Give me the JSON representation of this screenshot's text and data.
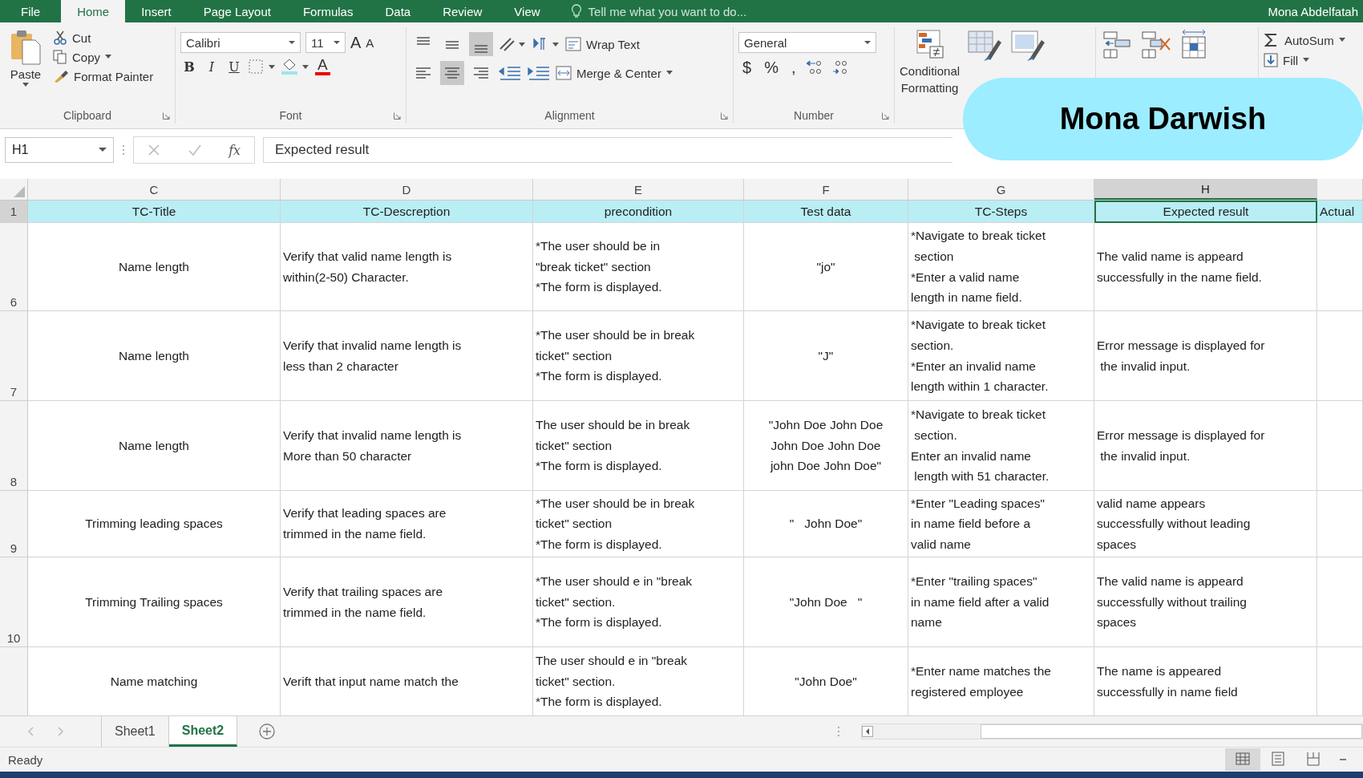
{
  "menu_tabs": [
    {
      "label": "File",
      "selected": false
    },
    {
      "label": "Home",
      "selected": true
    },
    {
      "label": "Insert",
      "selected": false
    },
    {
      "label": "Page Layout",
      "selected": false
    },
    {
      "label": "Formulas",
      "selected": false
    },
    {
      "label": "Data",
      "selected": false
    },
    {
      "label": "Review",
      "selected": false
    },
    {
      "label": "View",
      "selected": false
    }
  ],
  "tell_me": "Tell me what you want to do...",
  "user": "Mona Abdelfatah",
  "ribbon": {
    "clipboard": {
      "paste": "Paste",
      "cut": "Cut",
      "copy": "Copy",
      "format_painter": "Format Painter",
      "label": "Clipboard"
    },
    "font": {
      "name": "Calibri",
      "size": "11",
      "grow": "A",
      "shrink": "A",
      "bold": "B",
      "italic": "I",
      "underline": "U",
      "color_letter": "A",
      "label": "Font"
    },
    "alignment": {
      "vertical": [
        {
          "selected": false
        },
        {
          "selected": false
        },
        {
          "selected": true
        }
      ],
      "horizontal": [
        {
          "selected": false
        },
        {
          "selected": true
        },
        {
          "selected": false
        }
      ],
      "wrap_text": "Wrap Text",
      "merge": "Merge & Center",
      "label": "Alignment"
    },
    "number": {
      "format": "General",
      "currency": "$",
      "percent": "%",
      "comma": ",",
      "label": "Number"
    },
    "styles": {
      "conditional": "Conditional",
      "conditional_2": "Formatting"
    },
    "editing": {
      "autosum": "AutoSum",
      "fill": "Fill"
    }
  },
  "name_badge": "Mona Darwish",
  "formula_bar": {
    "name_box": "H1",
    "fx": "fx",
    "content": "Expected result"
  },
  "columns": [
    {
      "letter": "C",
      "selected": false
    },
    {
      "letter": "D",
      "selected": false
    },
    {
      "letter": "E",
      "selected": false
    },
    {
      "letter": "F",
      "selected": false
    },
    {
      "letter": "G",
      "selected": false
    },
    {
      "letter": "H",
      "selected": true
    },
    {
      "selected": false
    }
  ],
  "rows": [
    {
      "number": "1",
      "selected": true,
      "cells": [
        "TC-Title",
        "TC-Descreption",
        "precondition",
        "Test data",
        "TC-Steps",
        "Expected result",
        "Actual"
      ]
    },
    {
      "number": "6",
      "selected": false,
      "cells": [
        "Name length",
        "Verify that valid name length is\nwithin(2-50) Character.",
        "*The user should be in\n\"break ticket\" section\n*The form is displayed.",
        "\"jo\"",
        "*Navigate to break ticket\n section\n*Enter a valid name\nlength in name field.",
        "The valid name is appeard\nsuccessfully in the name field."
      ]
    },
    {
      "number": "7",
      "selected": false,
      "cells": [
        "Name length",
        "Verify that invalid name length is\nless than 2 character",
        "*The user should be in break\nticket\" section\n*The form is displayed.",
        "\"J\"",
        "*Navigate to break ticket\nsection.\n*Enter an invalid name\nlength within 1 character.",
        "Error message is displayed for\n the invalid input."
      ]
    },
    {
      "number": "8",
      "selected": false,
      "cells": [
        "Name length",
        "Verify that invalid name length is\nMore than 50 character",
        "The user should be in break\nticket\" section\n*The form is displayed.",
        "\"John Doe John Doe\nJohn Doe John Doe\njohn Doe John Doe\"",
        "*Navigate to break ticket\n section.\nEnter an invalid name\n length with 51 character.",
        "Error message is displayed for\n the invalid input."
      ]
    },
    {
      "number": "9",
      "selected": false,
      "cells": [
        "Trimming leading spaces",
        "Verify that leading spaces are\ntrimmed in the name field.",
        "*The user should be in break\nticket\" section\n*The form is displayed.",
        "\"   John Doe\"",
        "*Enter \"Leading spaces\"\nin name field before a\nvalid name",
        "valid name appears\nsuccessfully without leading\nspaces"
      ]
    },
    {
      "number": "10",
      "selected": false,
      "cells": [
        "Trimming Trailing spaces",
        "Verify that trailing spaces are\ntrimmed in the name field.",
        "*The user should e in \"break\nticket\" section.\n*The form is displayed.",
        "\"John Doe   \"",
        "*Enter \"trailing spaces\"\nin name field after a valid\nname",
        "The valid name is appeard\nsuccessfully without trailing\nspaces"
      ]
    },
    {
      "selected": false,
      "cells": [
        "Name matching",
        "Verift that input name match the",
        "The user should e in \"break\nticket\" section.\n*The form is displayed.",
        "\"John Doe\"",
        "*Enter name matches the\nregistered employee",
        "The name is appeared\nsuccessfully in name field"
      ]
    }
  ],
  "sheets": [
    {
      "label": "Sheet1",
      "selected": false
    },
    {
      "label": "Sheet2",
      "selected": true
    }
  ],
  "status": "Ready"
}
